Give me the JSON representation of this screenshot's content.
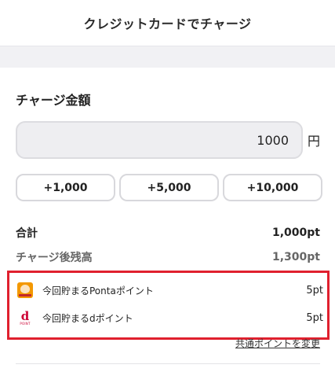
{
  "header": {
    "title": "クレジットカードでチャージ"
  },
  "charge": {
    "section_title": "チャージ金額",
    "amount_value": "1000",
    "currency_unit": "円",
    "quick_buttons": [
      "+1,000",
      "+5,000",
      "+10,000"
    ]
  },
  "summary": {
    "total_label": "合計",
    "total_value": "1,000pt",
    "balance_label": "チャージ後残高",
    "balance_value": "1,300pt"
  },
  "points": {
    "ponta_label": "今回貯まるPontaポイント",
    "ponta_value": "5pt",
    "dpoint_label": "今回貯まるdポイント",
    "dpoint_value": "5pt",
    "dpoint_logo_text": "POINT",
    "change_link": "共通ポイントを変更"
  },
  "colors": {
    "highlight_border": "#e0202e",
    "band_background": "#f1f1f4",
    "ponta_orange": "#f39800",
    "dpoint_red": "#cc0033"
  },
  "icons": [
    "ponta-logo-icon",
    "dpoint-logo-icon"
  ]
}
